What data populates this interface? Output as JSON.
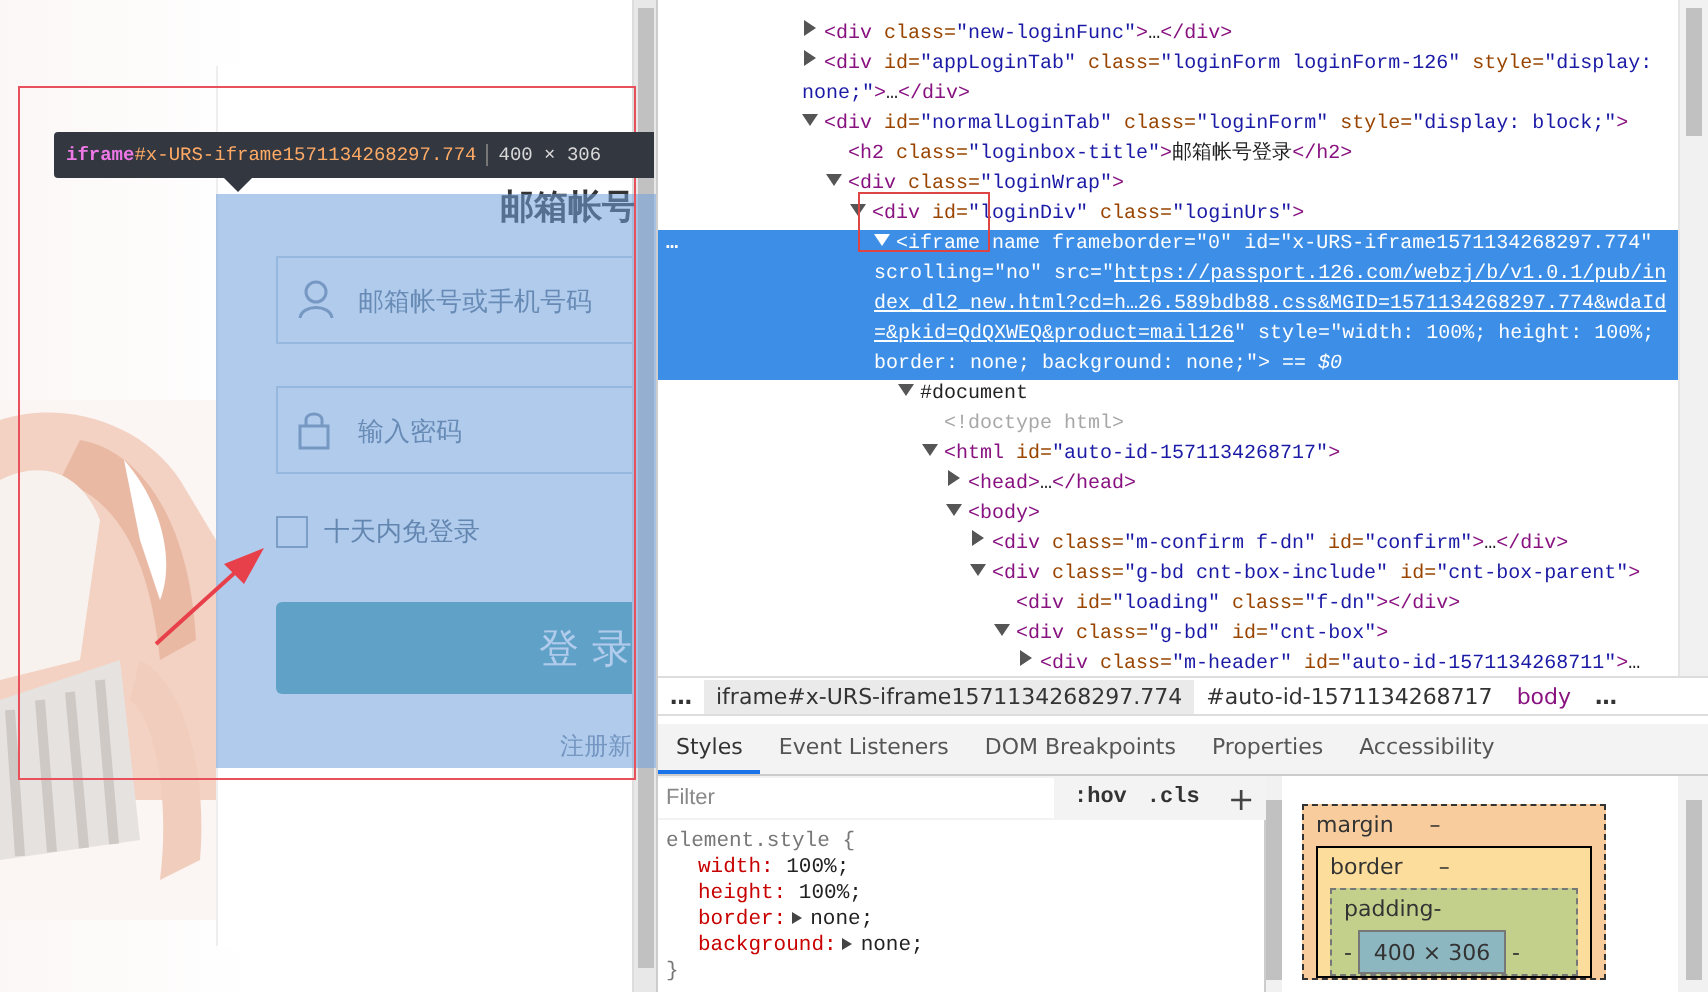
{
  "page": {
    "login": {
      "title": "邮箱帐号",
      "user_field": {
        "placeholder": "邮箱帐号或手机号码"
      },
      "password_field": {
        "placeholder": "输入密码"
      },
      "remember": {
        "label": "十天内免登录",
        "checked": false
      },
      "submit": "登 录",
      "register_link": "注册新"
    },
    "tooltip": {
      "tag": "iframe",
      "id": "#x-URS-iframe1571134268297.774",
      "size": "400 × 306"
    }
  },
  "elements": {
    "selected_marker": "…",
    "tree": [
      {
        "code": [
          {
            "kind": "tag",
            "text": "<div"
          },
          {
            "kind": "attr",
            "text": " class="
          },
          {
            "kind": "value",
            "text": "\"new-loginFunc\""
          },
          {
            "kind": "tag",
            "text": ">"
          },
          {
            "kind": "text",
            "text": "…"
          },
          {
            "kind": "tag",
            "text": "</div>"
          }
        ],
        "expanded": false,
        "selected": false
      },
      {
        "code": [
          {
            "kind": "tag",
            "text": "<div"
          },
          {
            "kind": "attr",
            "text": " id="
          },
          {
            "kind": "value",
            "text": "\"appLoginTab\""
          },
          {
            "kind": "attr",
            "text": " class="
          },
          {
            "kind": "value",
            "text": "\"loginForm loginForm-126\""
          },
          {
            "kind": "attr",
            "text": " style="
          },
          {
            "kind": "value",
            "text": "\"display: none;\""
          },
          {
            "kind": "tag",
            "text": ">"
          },
          {
            "kind": "text",
            "text": "…"
          },
          {
            "kind": "tag",
            "text": "</div>"
          }
        ],
        "expanded": false,
        "selected": false
      },
      {
        "code": [
          {
            "kind": "tag",
            "text": "<div"
          },
          {
            "kind": "attr",
            "text": " id="
          },
          {
            "kind": "value",
            "text": "\"normalLoginTab\""
          },
          {
            "kind": "attr",
            "text": " class="
          },
          {
            "kind": "value",
            "text": "\"loginForm\""
          },
          {
            "kind": "attr",
            "text": " style="
          },
          {
            "kind": "value",
            "text": "\"display: block;\""
          },
          {
            "kind": "tag",
            "text": ">"
          }
        ],
        "expanded": true,
        "selected": false,
        "children": [
          {
            "code": [
              {
                "kind": "tag",
                "text": "<h2"
              },
              {
                "kind": "attr",
                "text": " class="
              },
              {
                "kind": "value",
                "text": "\"loginbox-title\""
              },
              {
                "kind": "tag",
                "text": ">"
              },
              {
                "kind": "text",
                "text": "邮箱帐号登录"
              },
              {
                "kind": "tag",
                "text": "</h2>"
              }
            ],
            "selected": false
          },
          {
            "code": [
              {
                "kind": "tag",
                "text": "<div"
              },
              {
                "kind": "attr",
                "text": " class="
              },
              {
                "kind": "value",
                "text": "\"loginWrap\""
              },
              {
                "kind": "tag",
                "text": ">"
              }
            ],
            "expanded": true,
            "selected": false,
            "children": [
              {
                "code": [
                  {
                    "kind": "tag",
                    "text": "<div"
                  },
                  {
                    "kind": "attr",
                    "text": " id="
                  },
                  {
                    "kind": "value",
                    "text": "\"loginDiv\""
                  },
                  {
                    "kind": "attr",
                    "text": " class="
                  },
                  {
                    "kind": "value",
                    "text": "\"loginUrs\""
                  },
                  {
                    "kind": "tag",
                    "text": ">"
                  }
                ],
                "expanded": true,
                "selected": false,
                "children": [
                  {
                    "code": [
                      {
                        "kind": "tag",
                        "text": "<iframe"
                      },
                      {
                        "kind": "attr",
                        "text": " name frameborder="
                      },
                      {
                        "kind": "value",
                        "text": "\"0\""
                      },
                      {
                        "kind": "attr",
                        "text": " id="
                      },
                      {
                        "kind": "value",
                        "text": "\"x-URS-iframe1571134268297.774\""
                      },
                      {
                        "kind": "attr",
                        "text": " scrolling="
                      },
                      {
                        "kind": "value",
                        "text": "\"no\""
                      },
                      {
                        "kind": "attr",
                        "text": " src="
                      },
                      {
                        "kind": "value",
                        "text": "\""
                      },
                      {
                        "kind": "link",
                        "text": "https://passport.126.com/webzj/b/v1.0.1/pub/index_dl2_new.html?cd=h…26.589bdb88.css&MGID=1571134268297.774&wdaId=&pkid=QdQXWEQ&product=mail126"
                      },
                      {
                        "kind": "value",
                        "text": "\""
                      },
                      {
                        "kind": "attr",
                        "text": " style="
                      },
                      {
                        "kind": "value",
                        "text": "\"width: 100%; height: 100%; border: none; background: none;\""
                      },
                      {
                        "kind": "tag",
                        "text": ">"
                      },
                      {
                        "kind": "marker",
                        "text": " == $0"
                      }
                    ],
                    "expanded": true,
                    "selected": true,
                    "children": [
                      {
                        "code": [
                          {
                            "kind": "text",
                            "text": "#document"
                          }
                        ],
                        "expanded": true,
                        "selected": false,
                        "children": [
                          {
                            "code": [
                              {
                                "kind": "doctype",
                                "text": "<!doctype html>"
                              }
                            ],
                            "selected": false
                          },
                          {
                            "code": [
                              {
                                "kind": "tag",
                                "text": "<html"
                              },
                              {
                                "kind": "attr",
                                "text": " id="
                              },
                              {
                                "kind": "value",
                                "text": "\"auto-id-1571134268717\""
                              },
                              {
                                "kind": "tag",
                                "text": ">"
                              }
                            ],
                            "expanded": true,
                            "selected": false,
                            "children": [
                              {
                                "code": [
                                  {
                                    "kind": "tag",
                                    "text": "<head>"
                                  },
                                  {
                                    "kind": "text",
                                    "text": "…"
                                  },
                                  {
                                    "kind": "tag",
                                    "text": "</head>"
                                  }
                                ],
                                "expanded": false,
                                "selected": false
                              },
                              {
                                "code": [
                                  {
                                    "kind": "tag",
                                    "text": "<body>"
                                  }
                                ],
                                "expanded": true,
                                "selected": false,
                                "children": [
                                  {
                                    "code": [
                                      {
                                        "kind": "tag",
                                        "text": "<div"
                                      },
                                      {
                                        "kind": "attr",
                                        "text": " class="
                                      },
                                      {
                                        "kind": "value",
                                        "text": "\"m-confirm f-dn\""
                                      },
                                      {
                                        "kind": "attr",
                                        "text": " id="
                                      },
                                      {
                                        "kind": "value",
                                        "text": "\"confirm\""
                                      },
                                      {
                                        "kind": "tag",
                                        "text": ">"
                                      },
                                      {
                                        "kind": "text",
                                        "text": "…"
                                      },
                                      {
                                        "kind": "tag",
                                        "text": "</div>"
                                      }
                                    ],
                                    "expanded": false,
                                    "selected": false
                                  },
                                  {
                                    "code": [
                                      {
                                        "kind": "tag",
                                        "text": "<div"
                                      },
                                      {
                                        "kind": "attr",
                                        "text": " class="
                                      },
                                      {
                                        "kind": "value",
                                        "text": "\"g-bd cnt-box-include\""
                                      },
                                      {
                                        "kind": "attr",
                                        "text": " id="
                                      },
                                      {
                                        "kind": "value",
                                        "text": "\"cnt-box-parent\""
                                      },
                                      {
                                        "kind": "tag",
                                        "text": ">"
                                      }
                                    ],
                                    "expanded": true,
                                    "selected": false,
                                    "children": [
                                      {
                                        "code": [
                                          {
                                            "kind": "tag",
                                            "text": "<div"
                                          },
                                          {
                                            "kind": "attr",
                                            "text": " id="
                                          },
                                          {
                                            "kind": "value",
                                            "text": "\"loading\""
                                          },
                                          {
                                            "kind": "attr",
                                            "text": " class="
                                          },
                                          {
                                            "kind": "value",
                                            "text": "\"f-dn\""
                                          },
                                          {
                                            "kind": "tag",
                                            "text": "></div>"
                                          }
                                        ],
                                        "selected": false
                                      },
                                      {
                                        "code": [
                                          {
                                            "kind": "tag",
                                            "text": "<div"
                                          },
                                          {
                                            "kind": "attr",
                                            "text": " class="
                                          },
                                          {
                                            "kind": "value",
                                            "text": "\"g-bd\""
                                          },
                                          {
                                            "kind": "attr",
                                            "text": " id="
                                          },
                                          {
                                            "kind": "value",
                                            "text": "\"cnt-box\""
                                          },
                                          {
                                            "kind": "tag",
                                            "text": ">"
                                          }
                                        ],
                                        "expanded": true,
                                        "selected": false,
                                        "children": [
                                          {
                                            "code": [
                                              {
                                                "kind": "tag",
                                                "text": "<div"
                                              },
                                              {
                                                "kind": "attr",
                                                "text": " class="
                                              },
                                              {
                                                "kind": "value",
                                                "text": "\"m-header\""
                                              },
                                              {
                                                "kind": "attr",
                                                "text": " id="
                                              },
                                              {
                                                "kind": "value",
                                                "text": "\"auto-id-1571134268711\""
                                              },
                                              {
                                                "kind": "tag",
                                                "text": ">"
                                              },
                                              {
                                                "kind": "text",
                                                "text": "…"
                                              }
                                            ],
                                            "expanded": false,
                                            "selected": false
                                          }
                                        ]
                                      }
                                    ]
                                  }
                                ]
                              }
                            ]
                          }
                        ]
                      }
                    ]
                  }
                ]
              }
            ]
          }
        ]
      }
    ]
  },
  "breadcrumbs": [
    {
      "label": "…",
      "kind": "more",
      "selected": false
    },
    {
      "label": "iframe#x-URS-iframe1571134268297.774",
      "kind": "node",
      "selected": true
    },
    {
      "label": "#auto-id-1571134268717",
      "kind": "node",
      "selected": false
    },
    {
      "label": "body",
      "kind": "tag",
      "selected": false
    },
    {
      "label": "…",
      "kind": "more",
      "selected": false
    }
  ],
  "tabs": [
    {
      "label": "Styles",
      "selected": true
    },
    {
      "label": "Event Listeners",
      "selected": false
    },
    {
      "label": "DOM Breakpoints",
      "selected": false
    },
    {
      "label": "Properties",
      "selected": false
    },
    {
      "label": "Accessibility",
      "selected": false
    }
  ],
  "styles": {
    "filter": {
      "placeholder": "Filter"
    },
    "hov": ":hov",
    "cls": ".cls",
    "add": "+",
    "selector": "element.style {",
    "close": "}",
    "props": [
      {
        "name": "width:",
        "value": "100%;",
        "expandable": false
      },
      {
        "name": "height:",
        "value": "100%;",
        "expandable": false
      },
      {
        "name": "border:",
        "value": "none;",
        "expandable": true
      },
      {
        "name": "background:",
        "value": "none;",
        "expandable": true
      }
    ]
  },
  "box_model": {
    "margin": {
      "label": "margin",
      "value": "–"
    },
    "border": {
      "label": "border",
      "value": "–"
    },
    "padding": {
      "label": "padding-",
      "marks": [
        "-",
        "-"
      ]
    },
    "content": "400 × 306"
  }
}
